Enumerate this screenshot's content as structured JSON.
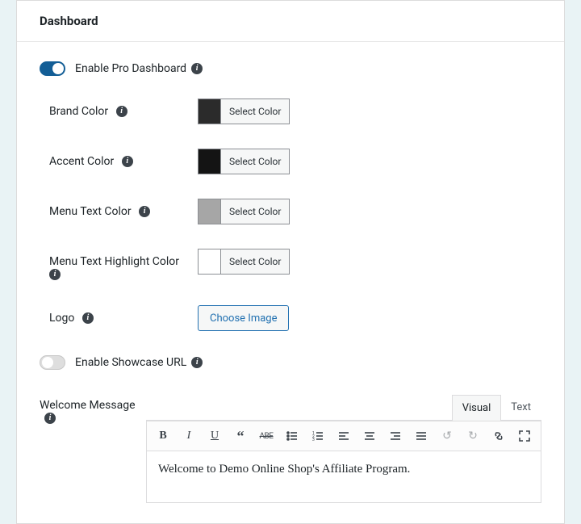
{
  "title": "Dashboard",
  "toggle1": {
    "label": "Enable Pro Dashboard",
    "checked": true
  },
  "toggle2": {
    "label": "Enable Showcase URL",
    "checked": false
  },
  "color_rows": {
    "brand": {
      "label": "Brand Color",
      "btn": "Select Color",
      "swatch": "#2b2b2b"
    },
    "accent": {
      "label": "Accent Color",
      "btn": "Select Color",
      "swatch": "#141414"
    },
    "menu_text": {
      "label": "Menu Text Color",
      "btn": "Select Color",
      "swatch": "#a6a6a6"
    },
    "menu_highlight": {
      "label": "Menu Text Highlight Color",
      "btn": "Select Color",
      "swatch": "#ffffff"
    }
  },
  "logo": {
    "label": "Logo",
    "btn": "Choose Image"
  },
  "editor": {
    "label": "Welcome Message",
    "tabs": {
      "visual": "Visual",
      "text": "Text"
    },
    "content": "Welcome to Demo Online Shop's Affiliate Program."
  }
}
